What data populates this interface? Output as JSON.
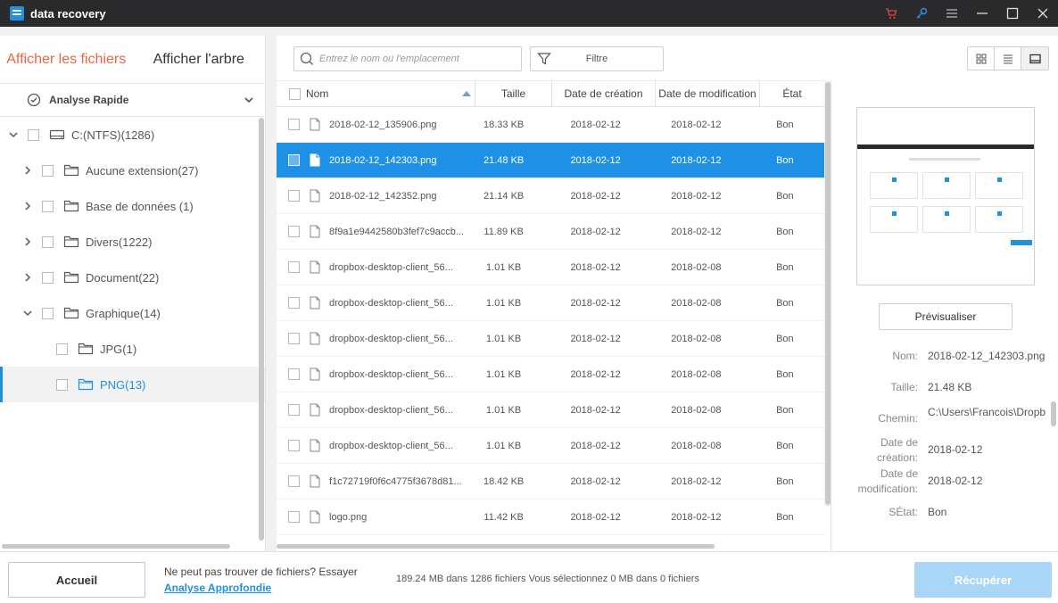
{
  "app": {
    "title": "data recovery",
    "titlebar_icons": [
      "cart-icon",
      "key-icon",
      "menu-icon",
      "minimize-icon",
      "maximize-icon",
      "close-icon"
    ],
    "accent": "#1e90e6",
    "tab_active_color": "#f0643f"
  },
  "left": {
    "tabs": [
      {
        "label": "Afficher les fichiers",
        "active": true
      },
      {
        "label": "Afficher l'arbre",
        "active": false
      }
    ],
    "scan_mode": "Analyse Rapide",
    "tree": [
      {
        "label": "C:(NTFS)(1286)",
        "icon": "drive-icon",
        "expanded": true,
        "level": 0
      },
      {
        "label": "Aucune extension(27)",
        "icon": "folder-icon",
        "expanded": false,
        "level": 1
      },
      {
        "label": "Base de données (1)",
        "icon": "folder-icon",
        "expanded": false,
        "level": 1
      },
      {
        "label": "Divers(1222)",
        "icon": "folder-icon",
        "expanded": false,
        "level": 1
      },
      {
        "label": "Document(22)",
        "icon": "folder-icon",
        "expanded": false,
        "level": 1
      },
      {
        "label": "Graphique(14)",
        "icon": "folder-icon",
        "expanded": true,
        "level": 1
      },
      {
        "label": "JPG(1)",
        "icon": "folder-icon",
        "level": 2
      },
      {
        "label": "PNG(13)",
        "icon": "folder-icon",
        "level": 2,
        "selected": true
      }
    ]
  },
  "toolbar": {
    "search_placeholder": "Entrez le nom ou l'emplacement",
    "filter_label": "Filtre"
  },
  "table": {
    "headers": {
      "name": "Nom",
      "size": "Taille",
      "created": "Date de création",
      "modified": "Date de modification",
      "state": "État"
    },
    "rows": [
      {
        "name": "2018-02-12_135906.png",
        "size": "18.33 KB",
        "created": "2018-02-12",
        "modified": "2018-02-12",
        "state": "Bon"
      },
      {
        "name": "2018-02-12_142303.png",
        "size": "21.48 KB",
        "created": "2018-02-12",
        "modified": "2018-02-12",
        "state": "Bon",
        "selected": true
      },
      {
        "name": "2018-02-12_142352.png",
        "size": "21.14 KB",
        "created": "2018-02-12",
        "modified": "2018-02-12",
        "state": "Bon"
      },
      {
        "name": "8f9a1e9442580b3fef7c9accb...",
        "size": "11.89 KB",
        "created": "2018-02-12",
        "modified": "2018-02-12",
        "state": "Bon"
      },
      {
        "name": "dropbox-desktop-client_56...",
        "size": "1.01 KB",
        "created": "2018-02-12",
        "modified": "2018-02-08",
        "state": "Bon"
      },
      {
        "name": "dropbox-desktop-client_56...",
        "size": "1.01 KB",
        "created": "2018-02-12",
        "modified": "2018-02-08",
        "state": "Bon"
      },
      {
        "name": "dropbox-desktop-client_56...",
        "size": "1.01 KB",
        "created": "2018-02-12",
        "modified": "2018-02-08",
        "state": "Bon"
      },
      {
        "name": "dropbox-desktop-client_56...",
        "size": "1.01 KB",
        "created": "2018-02-12",
        "modified": "2018-02-08",
        "state": "Bon"
      },
      {
        "name": "dropbox-desktop-client_56...",
        "size": "1.01 KB",
        "created": "2018-02-12",
        "modified": "2018-02-08",
        "state": "Bon"
      },
      {
        "name": "dropbox-desktop-client_56...",
        "size": "1.01 KB",
        "created": "2018-02-12",
        "modified": "2018-02-08",
        "state": "Bon"
      },
      {
        "name": "f1c72719f0f6c4775f3678d81...",
        "size": "18.42 KB",
        "created": "2018-02-12",
        "modified": "2018-02-12",
        "state": "Bon"
      },
      {
        "name": "logo.png",
        "size": "11.42 KB",
        "created": "2018-02-12",
        "modified": "2018-02-12",
        "state": "Bon"
      }
    ]
  },
  "details": {
    "preview_button": "Prévisualiser",
    "name_label": "Nom:",
    "name_value": "2018-02-12_142303.png",
    "size_label": "Taille:",
    "size_value": "21.48 KB",
    "path_label": "Chemin:",
    "path_value": "C:\\Users\\Francois\\Dropb",
    "created_label": "Date de création:",
    "created_value": "2018-02-12",
    "modified_label": "Date de modification:",
    "modified_value": "2018-02-12",
    "state_label": "SÉtat:",
    "state_value": "Bon"
  },
  "footer": {
    "home_button": "Accueil",
    "hint": "Ne peut pas trouver de fichiers? Essayer",
    "deep_scan_link": "Analyse Approfondie",
    "status": "189.24 MB dans 1286 fichiers  Vous sélectionnez 0 MB dans 0 fichiers",
    "recover_button": "Récupérer"
  }
}
